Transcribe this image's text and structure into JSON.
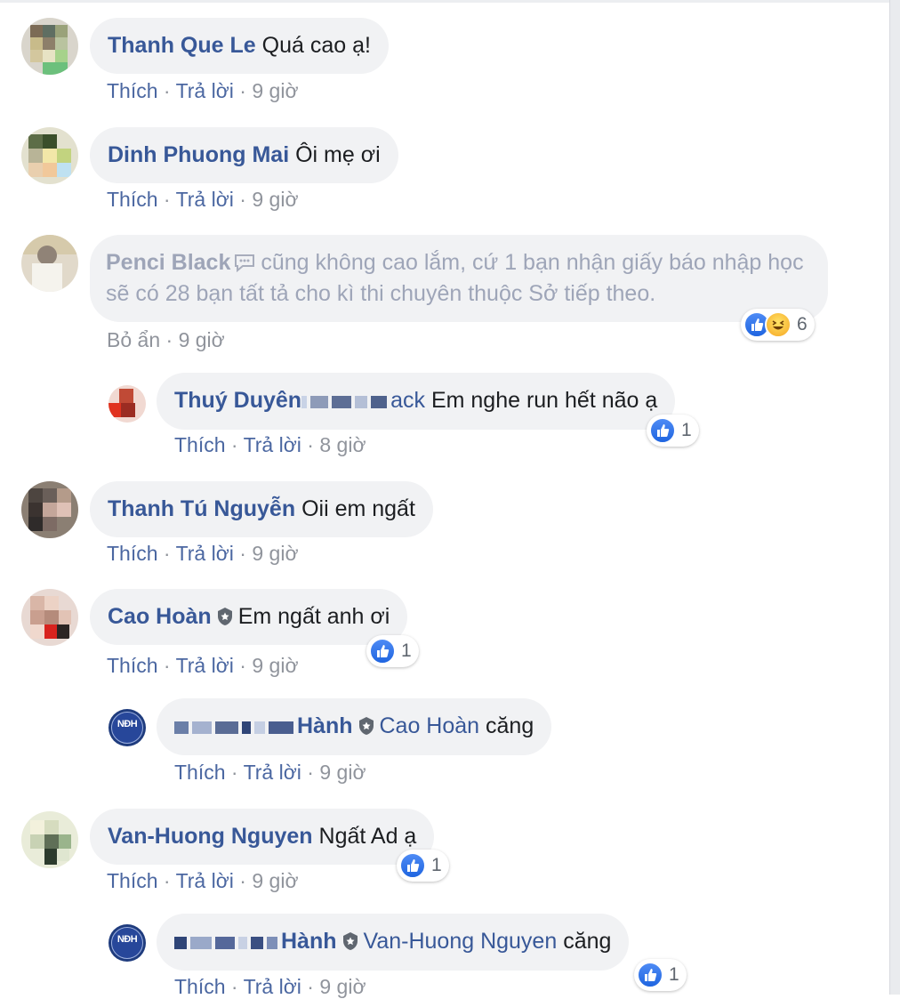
{
  "actions": {
    "like": "Thích",
    "reply": "Trả lời",
    "hide": "Bỏ ẩn",
    "dot": " · "
  },
  "comments": [
    {
      "name": "Thanh Que Le",
      "text": "Quá cao ạ!",
      "time": "9 giờ"
    },
    {
      "name": "Dinh Phuong Mai",
      "text": "Ôi mẹ ơi",
      "time": "9 giờ"
    },
    {
      "name": "Penci Black",
      "text": "cũng không cao lắm, cứ 1 bạn nhận giấy báo nhập học sẽ có 28 bạn tất tả cho kì thi chuyên thuộc Sở tiếp theo.",
      "time": "9 giờ",
      "reactions": "6",
      "reply": {
        "name": "Thuý Duyên",
        "tag_partial": "ack",
        "text": "Em nghe run hết não ạ",
        "time": "8 giờ",
        "reactions": "1"
      }
    },
    {
      "name": "Thanh Tú Nguyễn",
      "text": "Oii em ngất",
      "time": "9 giờ"
    },
    {
      "name": "Cao Hoàn",
      "text": "Em ngất anh ơi",
      "time": "9 giờ",
      "reactions": "1",
      "reply": {
        "name_partial": "Hành",
        "tag": "Cao Hoàn",
        "text": "căng",
        "time": "9 giờ"
      }
    },
    {
      "name": "Van-Huong Nguyen",
      "text": "Ngất Ad ạ",
      "time": "9 giờ",
      "reactions": "1",
      "reply": {
        "name_partial": "Hành",
        "tag": "Van-Huong Nguyen",
        "text": "căng",
        "time": "9 giờ",
        "reactions": "1"
      }
    }
  ],
  "page_avatar_label": "NĐH",
  "colors": {
    "link": "#385898",
    "bubble": "#f1f2f4",
    "meta": "#90949c",
    "like": "#1f65e0"
  }
}
